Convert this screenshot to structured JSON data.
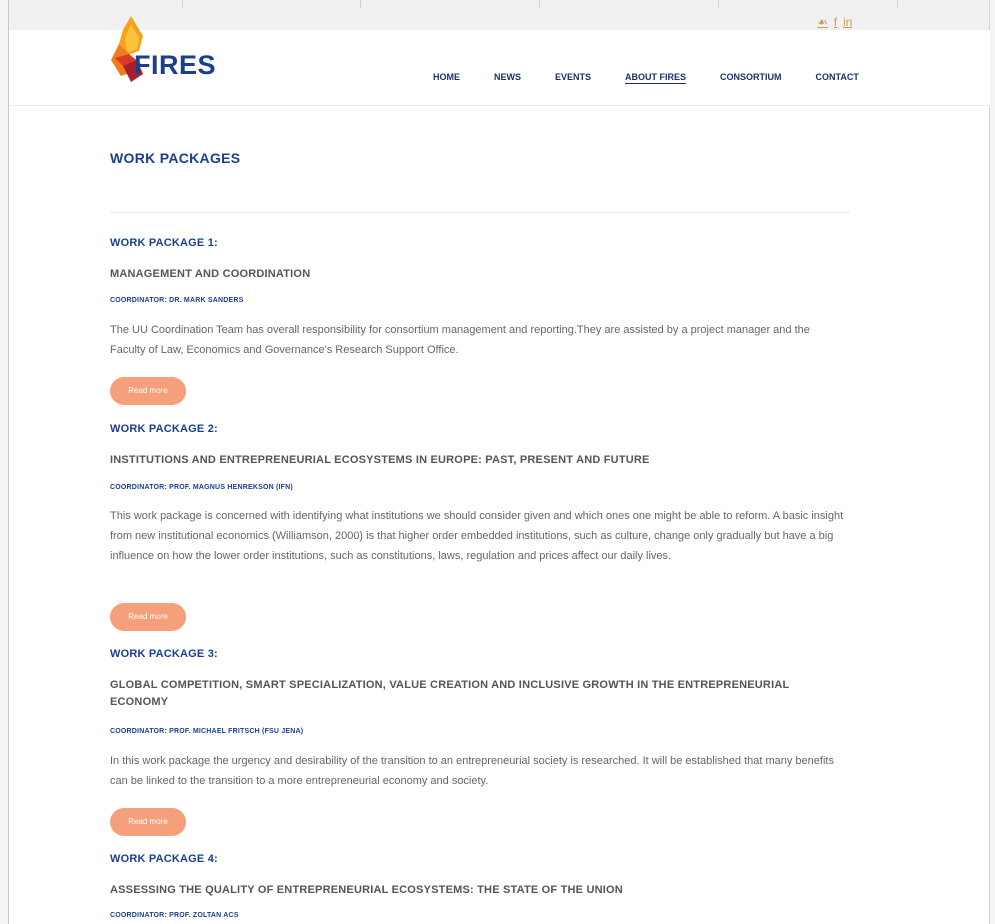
{
  "header": {
    "logo_text": "FIRES",
    "social": [
      "☙",
      "f",
      "in"
    ],
    "nav": [
      {
        "label": "HOME"
      },
      {
        "label": "NEWS"
      },
      {
        "label": "EVENTS"
      },
      {
        "label": "ABOUT FIRES",
        "active": true
      },
      {
        "label": "CONSORTIUM"
      },
      {
        "label": "CONTACT"
      }
    ]
  },
  "page": {
    "title": "WORK PACKAGES"
  },
  "work_packages": [
    {
      "label": "WORK PACKAGE 1:",
      "title": "MANAGEMENT AND COORDINATION",
      "coordinator": "COORDINATOR: DR. MARK SANDERS",
      "description": "The UU Coordination Team has overall responsibility for consortium management and reporting.They are assisted by a project manager and the Faculty of Law, Economics and Governance's Research Support Office.",
      "button": "Read more"
    },
    {
      "label": "WORK PACKAGE 2:",
      "title": "INSTITUTIONS AND ENTREPRENEURIAL ECOSYSTEMS IN EUROPE: PAST, PRESENT AND FUTURE",
      "coordinator": "COORDINATOR: PROF. MAGNUS HENREKSON (IFN)",
      "description": "This work package is concerned with identifying what institutions we should consider given and which ones one might be able to reform. A basic insight from new institutional economics (Williamson, 2000) is that higher order embedded institutions, such as culture, change only gradually but have a big influence on how the lower order institutions, such as constitutions, laws, regulation and prices affect our daily lives.",
      "button": "Read more"
    },
    {
      "label": "WORK PACKAGE 3:",
      "title": "GLOBAL COMPETITION, SMART SPECIALIZATION, VALUE CREATION AND INCLUSIVE GROWTH IN THE ENTREPRENEURIAL ECONOMY",
      "coordinator": "COORDINATOR: PROF. MICHAEL FRITSCH (FSU JENA)",
      "description": "In this work package the urgency and desirability of the transition to an entrepreneurial society is researched. It will be established that many benefits can be linked to the transition to a more entrepreneurial economy and society.",
      "button": "Read more"
    },
    {
      "label": "WORK PACKAGE 4:",
      "title": "ASSESSING THE QUALITY OF ENTREPRENEURIAL ECOSYSTEMS: THE STATE OF THE UNION",
      "coordinator": "COORDINATOR: PROF. ZOLTAN ACS"
    }
  ],
  "colors": {
    "primary": "#1a3f8f",
    "button": "#f6a07b",
    "text": "#666666"
  },
  "icons": {
    "logo": "fire-logo-icon",
    "social": [
      "twitter-icon",
      "facebook-icon",
      "linkedin-icon"
    ]
  }
}
